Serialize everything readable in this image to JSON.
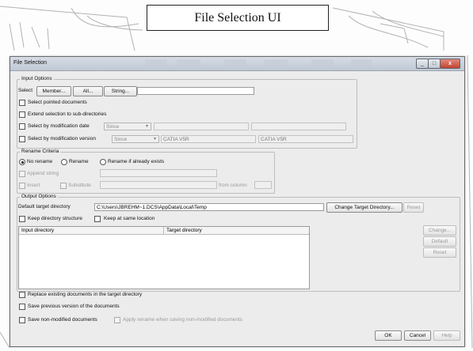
{
  "caption": "File Selection UI",
  "window": {
    "title": "File Selection",
    "controls": {
      "minimize": "_",
      "maximize": "□",
      "close": "x"
    }
  },
  "input_options": {
    "group_label": "Input Options",
    "select_label": "Select",
    "member_button": "Member...",
    "all_button": "All...",
    "string_button": "String...",
    "select_value": "",
    "select_pointed": "Select pointed documents",
    "extend_selection": "Extend selection to sub-directories",
    "by_mod_date": "Select by modification date",
    "mod_date_combo": "Since",
    "by_mod_version": "Select by modification version",
    "mod_version_combo": "Since",
    "version_from": "CATIA V5R",
    "version_to": "CATIA V5R"
  },
  "rename_criteria": {
    "group_label": "Rename Criteria",
    "no_rename": "No rename",
    "rename": "Rename",
    "rename_if_exists": "Rename if already exists",
    "append_string": "Append string",
    "insert": "Insert",
    "substitute": "Substitute",
    "from_column": "from column"
  },
  "output_options": {
    "group_label": "Output Options",
    "default_target_label": "Default target directory",
    "default_target_value": "C:\\Users\\JBREHM~1.DCS\\AppData\\Local\\Temp",
    "change_target_button": "Change Target Directory...",
    "reset_button": "Reset",
    "keep_structure": "Keep directory structure",
    "keep_location": "Keep at same location",
    "table_headers": [
      "Input directory",
      "Target directory"
    ],
    "side_change": "Change...",
    "side_default": "Default",
    "side_reset": "Reset"
  },
  "options": {
    "replace_existing": "Replace existing documents in the target directory",
    "save_previous": "Save previous version of the documents",
    "save_non_modified": "Save non-modified documents",
    "apply_rename": "Apply rename when saving non-modified documents"
  },
  "footer": {
    "ok": "OK",
    "cancel": "Cancel",
    "help": "Help"
  }
}
